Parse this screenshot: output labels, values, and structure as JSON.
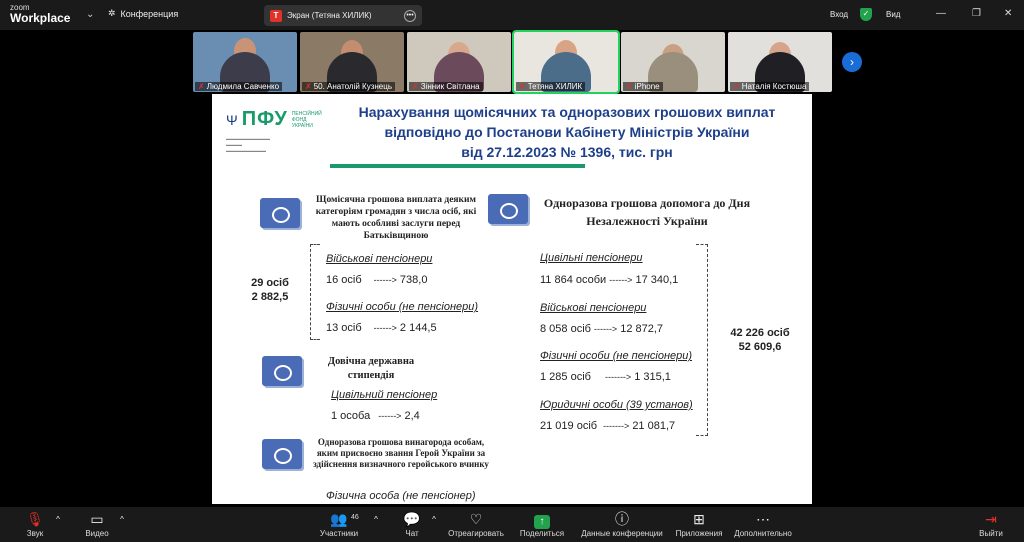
{
  "app": {
    "logo_small": "zoom",
    "logo_big": "Workplace"
  },
  "top": {
    "conference": "Конференция",
    "screen_title": "Экран (Тетяна ХИЛИК)",
    "screen_badge": "Т",
    "login": "Вход",
    "view": "Вид"
  },
  "participants": [
    {
      "name": "Людмила Савченко"
    },
    {
      "name": "50. Анатолій Кузнець"
    },
    {
      "name": "Зінник Світлана"
    },
    {
      "name": "Тетяна ХИЛИК"
    },
    {
      "name": "iPhone"
    },
    {
      "name": "Наталія Костюша"
    }
  ],
  "slide": {
    "title_line1": "Нарахування щомісячних та одноразових грошових виплат",
    "title_line2": "відповідно до Постанови Кабінету Міністрів України",
    "title_line3": "від 27.12.2023 № 1396, тис. грн",
    "pfu_logo": "ПФУ",
    "pfu_sub": "ПЕНСІЙНИЙ ФОНД УКРАЇНИ",
    "left": {
      "monthly_title": "Щомісячна грошова виплата деяким категоріям громадян з числа осіб, які мають особливі заслуги перед Батьківщиною",
      "total_persons": "29 осіб",
      "total_sum": "2 882,5",
      "cat1": "Військові пенсіонери",
      "cat1_persons": "16 осіб",
      "cat1_sum": "738,0",
      "cat2": "Фізичні особи (не пенсіонери)",
      "cat2_persons": "13 осіб",
      "cat2_sum": "2 144,5",
      "stipend_title": "Довічна державна стипендія",
      "stipend_cat": "Цивільний пенсіонер",
      "stipend_persons": "1 особа",
      "stipend_sum": "2,4",
      "reward_title": "Одноразова грошова винагорода особам, яким присвоєно звання Герой України за здійснення визначного геройського вчинку",
      "reward_cat": "Фізична особа (не пенсіонер)"
    },
    "right": {
      "title": "Одноразова грошова допомога до Дня Незалежності України",
      "c1": "Цивільні пенсіонери",
      "c1_persons": "11 864 особи",
      "c1_sum": "17 340,1",
      "c2": "Військові пенсіонери",
      "c2_persons": "8 058 осіб",
      "c2_sum": "12 872,7",
      "c3": "Фізичні особи (не пенсіонери)",
      "c3_persons": "1 285 осіб",
      "c3_sum": "1 315,1",
      "c4": "Юридичні особи (39 установ)",
      "c4_persons": "21 019 осіб",
      "c4_sum": "21 081,7",
      "total_persons": "42 226 осіб",
      "total_sum": "52 609,6"
    }
  },
  "bottom": {
    "audio": "Звук",
    "video": "Видео",
    "participants": "Участники",
    "participants_count": "46",
    "chat": "Чат",
    "react": "Отреагировать",
    "share": "Поделиться",
    "info": "Данные конференции",
    "apps": "Приложения",
    "more": "Дополнительно",
    "leave": "Выйти"
  }
}
